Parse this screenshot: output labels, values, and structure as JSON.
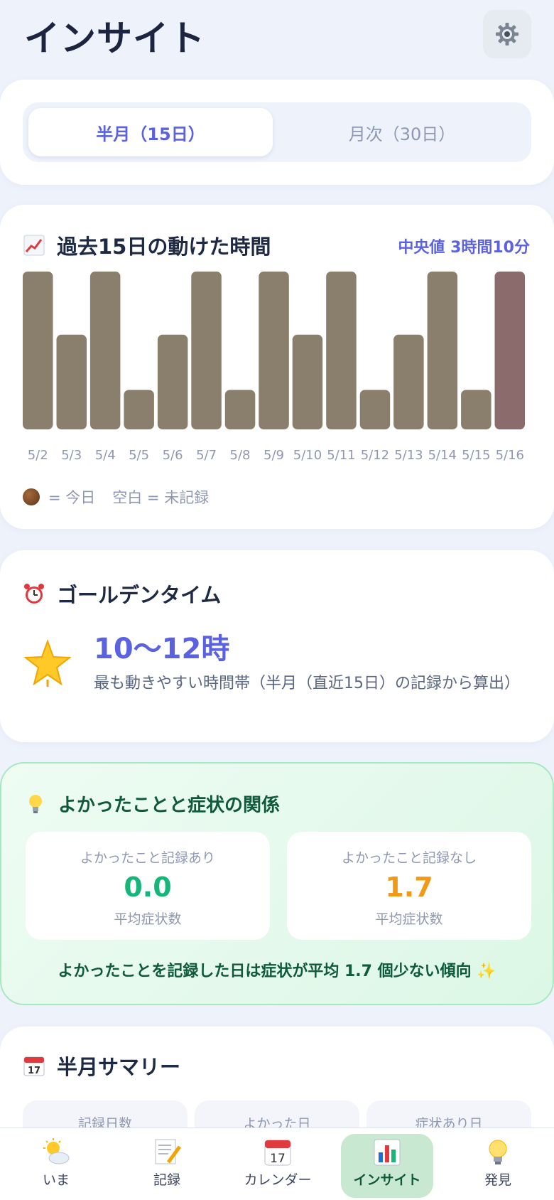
{
  "header": {
    "title": "インサイト",
    "settings_icon": "gear-icon"
  },
  "period_switch": {
    "options": [
      {
        "label": "半月（15日）",
        "active": true
      },
      {
        "label": "月次（30日）",
        "active": false
      }
    ]
  },
  "activity_card": {
    "icon": "chart-increasing-icon",
    "title": "過去15日の動けた時間",
    "median": "中央値 3時間10分",
    "legend_today": "= 今日",
    "legend_blank": "空白 = 未記録",
    "colors": {
      "bar": "#8a7e6c",
      "today": "#8b6b6b"
    }
  },
  "chart_data": {
    "type": "bar",
    "categories": [
      "5/2",
      "5/3",
      "5/4",
      "5/5",
      "5/6",
      "5/7",
      "5/8",
      "5/9",
      "5/10",
      "5/11",
      "5/12",
      "5/13",
      "5/14",
      "5/15",
      "5/16"
    ],
    "values": [
      4,
      2.4,
      4,
      1,
      2.4,
      4,
      1,
      4,
      2.4,
      4,
      1,
      2.4,
      4,
      1,
      4
    ],
    "highlight_index": 14,
    "title": "過去15日の動けた時間",
    "xlabel": "",
    "ylabel": "",
    "ylim": [
      0,
      4
    ],
    "grid": false
  },
  "golden_time": {
    "icon": "alarm-clock-icon",
    "title": "ゴールデンタイム",
    "star_icon": "star-icon",
    "value": "10〜12時",
    "description": "最も動きやすい時間帯（半月（直近15日）の記録から算出）"
  },
  "good_things": {
    "icon": "light-bulb-icon",
    "title": "よかったことと症状の関係",
    "with": {
      "label": "よかったこと記録あり",
      "value": "0.0",
      "sub": "平均症状数",
      "color": "#16b57a"
    },
    "without": {
      "label": "よかったこと記録なし",
      "value": "1.7",
      "sub": "平均症状数",
      "color": "#f29a16"
    },
    "message": "よかったことを記録した日は症状が平均 1.7 個少ない傾向 ✨"
  },
  "summary": {
    "icon": "calendar-icon",
    "title": "半月サマリー",
    "tiles": [
      "記録日数",
      "よかった日",
      "症状あり日"
    ]
  },
  "tabbar": {
    "tabs": [
      {
        "label": "いま",
        "icon": "sun-cloud-icon",
        "active": false
      },
      {
        "label": "記録",
        "icon": "memo-icon",
        "active": false
      },
      {
        "label": "カレンダー",
        "icon": "calendar-icon",
        "active": false
      },
      {
        "label": "インサイト",
        "icon": "bar-chart-icon",
        "active": true
      },
      {
        "label": "発見",
        "icon": "light-bulb-icon",
        "active": false
      }
    ]
  }
}
